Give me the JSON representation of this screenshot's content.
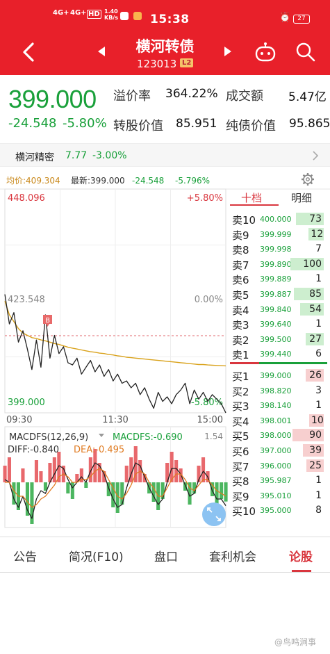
{
  "status_bar": {
    "network_1": "4G+",
    "network_2": "4G+",
    "hd": "HD",
    "speed": "1.40 KB/s",
    "time": "15:38",
    "battery": "27"
  },
  "header": {
    "title": "横河转债",
    "code": "123013",
    "level_badge": "L2"
  },
  "quote": {
    "price": "399.000",
    "change": "-24.548",
    "change_pct": "-5.80%",
    "premium_label": "溢价率",
    "premium_value": "364.22%",
    "turnover_label": "成交额",
    "turnover_value": "5.47亿",
    "conv_value_label": "转股价值",
    "conv_value": "85.951",
    "bond_value_label": "纯债价值",
    "bond_value": "95.865"
  },
  "related": {
    "name": "横河精密",
    "price": "7.77",
    "change_pct": "-3.00%"
  },
  "chart_header": {
    "avg_label": "均价:409.304",
    "latest_label": "最新:399.000",
    "change": "-24.548",
    "change_pct": "-5.796%"
  },
  "chart_labels": {
    "high": "448.096",
    "high_pct": "+5.80%",
    "mid": "423.548",
    "mid_pct": "0.00%",
    "low": "399.000",
    "low_pct": "-5.80%",
    "t_start": "09:30",
    "t_mid": "11:30",
    "t_end": "15:00",
    "marker": "B"
  },
  "macd": {
    "label": "MACDFS(12,26,9)",
    "macdfs": "MACDFS:-0.690",
    "diff": "DIFF:-0.840",
    "dea": "DEA:-0.495",
    "scale_top": "1.54"
  },
  "chart_data": {
    "type": "line",
    "x_range": [
      "09:30",
      "15:00"
    ],
    "ylim": [
      399.0,
      448.096
    ],
    "baseline": 423.548,
    "series": [
      {
        "name": "最新",
        "values": [
          425.0,
          418.5,
          421.0,
          414.5,
          417.0,
          413.0,
          408.5,
          415.0,
          409.0,
          420.5,
          411.0,
          416.0,
          412.0,
          413.5,
          410.0,
          409.5,
          411.0,
          407.5,
          409.0,
          410.5,
          408.0,
          409.5,
          407.0,
          408.5,
          406.0,
          407.5,
          405.5,
          406.0,
          404.5,
          405.5,
          403.0,
          404.5,
          402.0,
          400.0,
          403.5,
          401.5,
          402.5,
          401.0,
          403.0,
          404.0,
          405.5,
          401.0,
          404.0,
          402.0,
          403.5,
          401.5,
          403.0,
          402.0,
          401.0,
          399.0
        ]
      },
      {
        "name": "均价",
        "values": [
          423.5,
          420.5,
          419.0,
          417.5,
          416.5,
          416.0,
          415.5,
          415.3,
          415.0,
          414.8,
          414.5,
          414.2,
          414.0,
          413.7,
          413.4,
          413.2,
          413.0,
          412.8,
          412.6,
          412.4,
          412.3,
          412.1,
          412.0,
          411.8,
          411.7,
          411.5,
          411.4,
          411.2,
          411.1,
          411.0,
          410.9,
          410.8,
          410.7,
          410.6,
          410.5,
          410.4,
          410.3,
          410.2,
          410.1,
          410.0,
          409.9,
          409.8,
          409.7,
          409.6,
          409.6,
          409.5,
          409.45,
          409.4,
          409.35,
          409.304
        ]
      }
    ],
    "macd_hist": [
      0.6,
      0.9,
      -0.8,
      -1.0,
      0.5,
      -1.2,
      -1.5,
      0.8,
      0.4,
      -0.3,
      0.7,
      0.9,
      1.1,
      0.6,
      -0.4,
      -0.6,
      0.3,
      0.5,
      -0.2,
      0.9,
      1.2,
      0.7,
      0.4,
      -0.5,
      -0.9,
      -1.1,
      -0.8,
      0.6,
      0.9,
      1.3,
      0.8,
      0.3,
      -0.4,
      -0.7,
      -1.0,
      -0.6,
      0.7,
      1.1,
      0.8,
      0.5,
      -0.3,
      -0.8,
      -0.4,
      0.6,
      0.9,
      0.4,
      -0.5,
      -0.8,
      -0.6,
      -0.69
    ],
    "diff": [
      0.1,
      0.0,
      -0.6,
      -0.9,
      -0.5,
      -1.0,
      -1.3,
      -0.6,
      -0.3,
      -0.4,
      0.0,
      0.3,
      0.6,
      0.5,
      0.1,
      -0.2,
      0.0,
      0.2,
      0.0,
      0.4,
      0.7,
      0.6,
      0.3,
      -0.2,
      -0.6,
      -0.9,
      -0.8,
      -0.2,
      0.3,
      0.7,
      0.6,
      0.2,
      -0.2,
      -0.5,
      -0.8,
      -0.6,
      0.0,
      0.5,
      0.5,
      0.3,
      -0.1,
      -0.5,
      -0.4,
      0.1,
      0.4,
      0.2,
      -0.3,
      -0.6,
      -0.6,
      -0.84
    ],
    "dea": [
      0.0,
      0.0,
      -0.3,
      -0.5,
      -0.5,
      -0.7,
      -0.9,
      -0.8,
      -0.6,
      -0.5,
      -0.3,
      -0.1,
      0.2,
      0.3,
      0.2,
      0.0,
      0.0,
      0.1,
      0.1,
      0.2,
      0.4,
      0.5,
      0.4,
      0.1,
      -0.2,
      -0.5,
      -0.6,
      -0.4,
      -0.1,
      0.3,
      0.4,
      0.3,
      0.0,
      -0.2,
      -0.5,
      -0.5,
      -0.2,
      0.1,
      0.3,
      0.3,
      0.1,
      -0.2,
      -0.3,
      -0.1,
      0.1,
      0.1,
      -0.1,
      -0.3,
      -0.4,
      -0.495
    ]
  },
  "order_book": {
    "tab_active": "十档",
    "tab_other": "明细",
    "asks": [
      {
        "name": "卖10",
        "price": "400.000",
        "vol": "73"
      },
      {
        "name": "卖9",
        "price": "399.999",
        "vol": "12"
      },
      {
        "name": "卖8",
        "price": "399.998",
        "vol": "7"
      },
      {
        "name": "卖7",
        "price": "399.890",
        "vol": "100"
      },
      {
        "name": "卖6",
        "price": "399.889",
        "vol": "1"
      },
      {
        "name": "卖5",
        "price": "399.887",
        "vol": "85"
      },
      {
        "name": "卖4",
        "price": "399.840",
        "vol": "54"
      },
      {
        "name": "卖3",
        "price": "399.640",
        "vol": "1"
      },
      {
        "name": "卖2",
        "price": "399.500",
        "vol": "27"
      },
      {
        "name": "卖1",
        "price": "399.440",
        "vol": "6"
      }
    ],
    "bids": [
      {
        "name": "买1",
        "price": "399.000",
        "vol": "26"
      },
      {
        "name": "买2",
        "price": "398.820",
        "vol": "3"
      },
      {
        "name": "买3",
        "price": "398.140",
        "vol": "1"
      },
      {
        "name": "买4",
        "price": "398.001",
        "vol": "10"
      },
      {
        "name": "买5",
        "price": "398.000",
        "vol": "90"
      },
      {
        "name": "买6",
        "price": "397.000",
        "vol": "39"
      },
      {
        "name": "买7",
        "price": "396.000",
        "vol": "25"
      },
      {
        "name": "买8",
        "price": "395.987",
        "vol": "1"
      },
      {
        "name": "买9",
        "price": "395.010",
        "vol": "1"
      },
      {
        "name": "买10",
        "price": "395.000",
        "vol": "8"
      }
    ]
  },
  "bottom_tabs": {
    "t1": "公告",
    "t2": "简况(F10)",
    "t3": "盘口",
    "t4": "套利机会",
    "t5": "论股"
  },
  "watermark": "@鸟鸣涧事",
  "colors": {
    "brand_red": "#e8202a",
    "down_green": "#19a03a",
    "up_red": "#d9363e",
    "avg_line": "#d9a21b"
  }
}
